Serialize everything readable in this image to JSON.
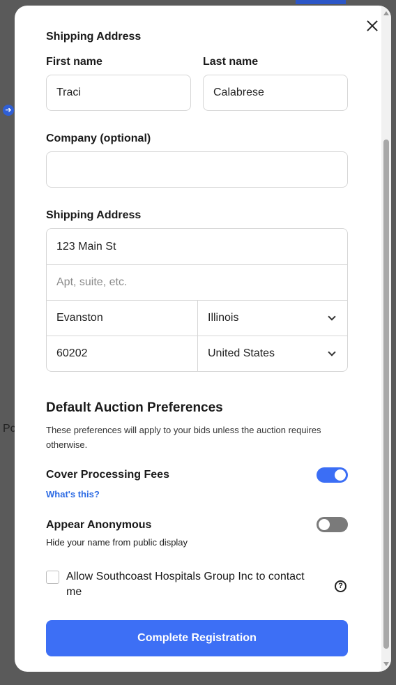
{
  "modal": {
    "shipping_heading": "Shipping Address",
    "first_name": {
      "label": "First name",
      "value": "Traci"
    },
    "last_name": {
      "label": "Last name",
      "value": "Calabrese"
    },
    "company": {
      "label": "Company (optional)",
      "value": ""
    },
    "address": {
      "label": "Shipping Address",
      "street": "123 Main St",
      "apt_placeholder": "Apt, suite, etc.",
      "city": "Evanston",
      "state": "Illinois",
      "zip": "60202",
      "country": "United States"
    },
    "preferences": {
      "title": "Default Auction Preferences",
      "subtitle": "These preferences will apply to your bids unless the auction requires otherwise.",
      "cover_fees": {
        "label": "Cover Processing Fees",
        "link": "What's this?",
        "enabled": true
      },
      "anonymous": {
        "label": "Appear Anonymous",
        "description": "Hide your name from public display",
        "enabled": false
      }
    },
    "contact": {
      "label": "Allow Southcoast Hospitals Group Inc to contact me",
      "checked": false,
      "help_glyph": "?"
    },
    "submit_label": "Complete Registration"
  },
  "background": {
    "partial_text": "Pc"
  },
  "colors": {
    "accent": "#3d6ff5",
    "link": "#2d6be4",
    "toggle_off": "#7a7a7a"
  }
}
